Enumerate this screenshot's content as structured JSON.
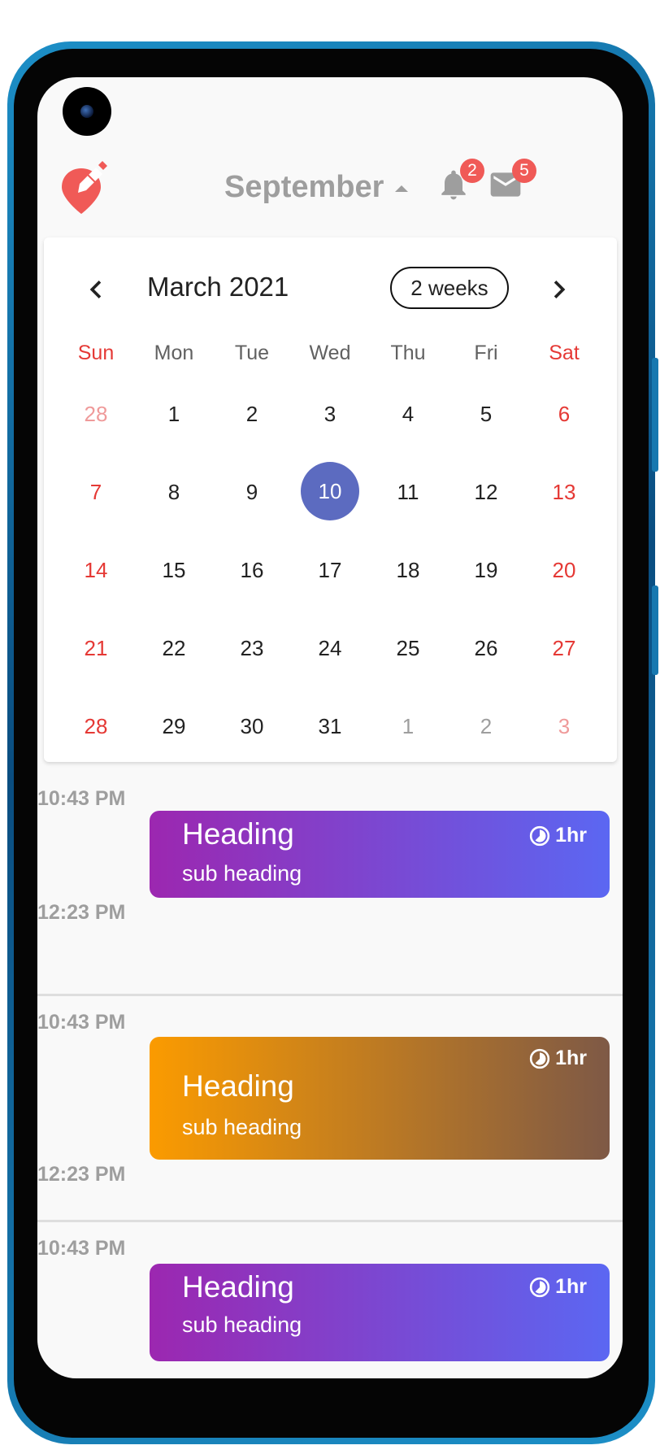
{
  "header": {
    "month_label": "September",
    "notifications_count": "2",
    "messages_count": "5"
  },
  "calendar": {
    "title": "March 2021",
    "format_button": "2 weeks",
    "weekdays": [
      "Sun",
      "Mon",
      "Tue",
      "Wed",
      "Thu",
      "Fri",
      "Sat"
    ],
    "weeks": [
      [
        "28",
        "1",
        "2",
        "3",
        "4",
        "5",
        "6"
      ],
      [
        "7",
        "8",
        "9",
        "10",
        "11",
        "12",
        "13"
      ],
      [
        "14",
        "15",
        "16",
        "17",
        "18",
        "19",
        "20"
      ],
      [
        "21",
        "22",
        "23",
        "24",
        "25",
        "26",
        "27"
      ],
      [
        "28",
        "29",
        "30",
        "31",
        "1",
        "2",
        "3"
      ]
    ],
    "selected_day": "10"
  },
  "events": [
    {
      "start": "10:43 PM",
      "end": "12:23 PM",
      "heading": "Heading",
      "sub": "sub heading",
      "duration": "1hr"
    },
    {
      "start": "10:43 PM",
      "end": "12:23 PM",
      "heading": "Heading",
      "sub": "sub heading",
      "duration": "1hr"
    },
    {
      "start": "10:43 PM",
      "heading": "Heading",
      "sub": "sub heading",
      "duration": "1hr"
    }
  ],
  "colors": {
    "accent_red": "#f05a57",
    "selected_day": "#5c6bc0",
    "weekend": "#e53935",
    "event_purple_start": "#9c27b0",
    "event_purple_end": "#5b67f2",
    "event_orange_start": "#fb9b00",
    "event_orange_end": "#7e5946"
  },
  "icons": [
    "edit-location-icon",
    "chevron-left-icon",
    "chevron-right-icon",
    "bell-icon",
    "mail-icon",
    "timelapse-icon"
  ]
}
